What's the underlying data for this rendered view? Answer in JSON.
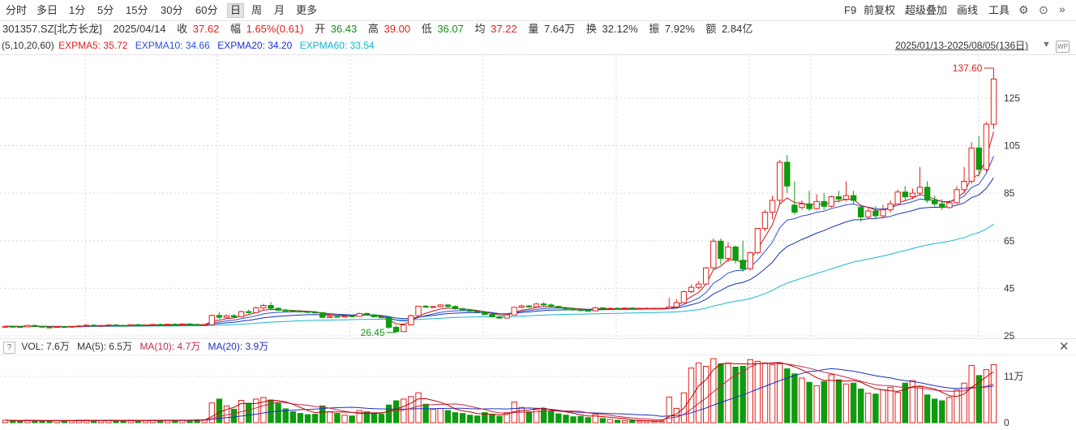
{
  "toolbar": {
    "periods": [
      "分时",
      "多日",
      "1分",
      "5分",
      "15分",
      "30分",
      "60分",
      "日",
      "周",
      "月",
      "更多"
    ],
    "active": "日",
    "right": [
      "F9",
      "前复权",
      "超级叠加",
      "画线",
      "工具"
    ]
  },
  "quote": {
    "code": "301357.SZ[北方长龙]",
    "date": "2025/04/14",
    "close_label": "收",
    "close": "37.62",
    "change_label": "幅",
    "change": "1.65%(0.61)",
    "open_label": "开",
    "open": "36.43",
    "high_label": "高",
    "high": "39.00",
    "low_label": "低",
    "low": "36.07",
    "avg_label": "均",
    "avg": "37.22",
    "vol_label": "量",
    "vol": "7.64万",
    "turnover_label": "换",
    "turnover": "32.12%",
    "amplitude_label": "振",
    "amplitude": "7.92%",
    "amount_label": "额",
    "amount": "2.84亿"
  },
  "ema": {
    "params": "(5,10,20,60)",
    "ema5": "EXPMA5: 35.72",
    "ema10": "EXPMA10: 34.66",
    "ema20": "EXPMA20: 34.20",
    "ema60": "EXPMA60: 33.54"
  },
  "range_label": "2025/01/13-2025/08/05(136日)",
  "vol_panel": {
    "q": "?",
    "vol": "VOL: 7.6万",
    "ma5": "MA(5): 6.5万",
    "ma10": "MA(10): 4.7万",
    "ma20": "MA(20): 3.9万"
  },
  "colors": {
    "up": "#e0201d",
    "down": "#0f9a0f",
    "ema5": "#c2181b",
    "ema10": "#2a4fd8",
    "ema20": "#1432b8",
    "ema60": "#19b8cc",
    "vma5": "#c00000",
    "vma10": "#c22a4a",
    "vma20": "#2030c0"
  },
  "chart_data": {
    "type": "candlestick",
    "ylim": [
      25,
      141
    ],
    "yticks": [
      25,
      45,
      65,
      85,
      105,
      125
    ],
    "vol_ylim": [
      0,
      16
    ],
    "vol_yticks_labels": [
      "0",
      "11万"
    ],
    "vol_yticks_values": [
      0,
      11
    ],
    "annotations": {
      "max": "137.60",
      "min": "26.45"
    },
    "candles": [
      [
        28.8,
        29.3,
        29.0,
        28.5
      ],
      [
        29.0,
        29.4,
        28.9,
        28.6
      ],
      [
        28.9,
        29.2,
        28.8,
        28.4
      ],
      [
        28.8,
        29.6,
        29.4,
        28.6
      ],
      [
        29.4,
        29.7,
        29.0,
        28.8
      ],
      [
        29.0,
        29.3,
        28.7,
        28.5
      ],
      [
        28.7,
        29.0,
        28.6,
        28.3
      ],
      [
        28.6,
        29.1,
        28.9,
        28.4
      ],
      [
        28.9,
        29.2,
        28.7,
        28.5
      ],
      [
        28.7,
        29.1,
        29.0,
        28.5
      ],
      [
        29.0,
        29.5,
        29.2,
        28.8
      ],
      [
        29.2,
        29.8,
        29.5,
        29.0
      ],
      [
        29.5,
        29.9,
        29.3,
        29.1
      ],
      [
        29.3,
        29.6,
        29.4,
        29.0
      ],
      [
        29.4,
        29.8,
        29.6,
        29.2
      ],
      [
        29.6,
        30.0,
        29.4,
        29.2
      ],
      [
        29.4,
        29.7,
        29.3,
        29.0
      ],
      [
        29.3,
        29.9,
        29.7,
        29.1
      ],
      [
        29.7,
        30.1,
        29.5,
        29.3
      ],
      [
        29.5,
        29.8,
        29.6,
        29.2
      ],
      [
        29.6,
        30.0,
        29.8,
        29.4
      ],
      [
        29.8,
        30.2,
        29.6,
        29.4
      ],
      [
        29.6,
        30.0,
        29.9,
        29.4
      ],
      [
        29.9,
        30.3,
        29.7,
        29.5
      ],
      [
        29.7,
        30.1,
        30.0,
        29.5
      ],
      [
        30.0,
        30.4,
        29.8,
        29.6
      ],
      [
        29.8,
        30.2,
        29.5,
        29.3
      ],
      [
        29.5,
        29.9,
        29.7,
        29.2
      ],
      [
        29.7,
        34.0,
        33.6,
        29.5
      ],
      [
        33.6,
        35.0,
        32.8,
        32.0
      ],
      [
        32.8,
        34.0,
        33.5,
        32.4
      ],
      [
        33.5,
        34.2,
        33.0,
        32.6
      ],
      [
        33.0,
        35.6,
        35.2,
        32.8
      ],
      [
        35.2,
        36.0,
        34.8,
        34.2
      ],
      [
        34.8,
        37.2,
        36.8,
        34.6
      ],
      [
        36.8,
        38.5,
        37.8,
        36.0
      ],
      [
        37.8,
        39.2,
        36.6,
        36.2
      ],
      [
        36.6,
        37.0,
        35.8,
        35.4
      ],
      [
        35.8,
        36.4,
        35.6,
        35.2
      ],
      [
        35.6,
        35.9,
        35.4,
        35.0
      ],
      [
        35.4,
        35.8,
        35.2,
        34.8
      ],
      [
        35.2,
        35.6,
        35.0,
        34.6
      ],
      [
        35.0,
        35.5,
        34.8,
        34.5
      ],
      [
        34.8,
        35.0,
        32.8,
        32.4
      ],
      [
        32.8,
        33.5,
        33.2,
        32.5
      ],
      [
        33.2,
        33.8,
        33.0,
        32.6
      ],
      [
        33.0,
        33.6,
        33.4,
        32.8
      ],
      [
        33.4,
        33.9,
        33.2,
        32.8
      ],
      [
        33.2,
        34.8,
        34.4,
        33.0
      ],
      [
        34.4,
        34.8,
        33.8,
        33.5
      ],
      [
        33.8,
        34.2,
        33.0,
        32.8
      ],
      [
        33.0,
        33.4,
        32.8,
        32.5
      ],
      [
        32.8,
        33.0,
        28.6,
        28.0
      ],
      [
        28.6,
        29.5,
        26.8,
        26.45
      ],
      [
        26.8,
        30.0,
        29.6,
        26.6
      ],
      [
        29.6,
        34.0,
        33.5,
        29.4
      ],
      [
        33.5,
        37.6,
        37.5,
        33.2
      ],
      [
        37.5,
        38.0,
        37.1,
        36.8
      ],
      [
        37.1,
        37.6,
        37.3,
        36.8
      ],
      [
        37.3,
        38.4,
        38.0,
        37.0
      ],
      [
        38.0,
        38.4,
        37.4,
        37.0
      ],
      [
        37.4,
        37.8,
        36.4,
        36.0
      ],
      [
        36.4,
        36.8,
        36.0,
        35.6
      ],
      [
        36.0,
        36.4,
        35.4,
        35.0
      ],
      [
        35.4,
        35.8,
        35.0,
        34.6
      ],
      [
        35.0,
        35.4,
        34.0,
        33.8
      ],
      [
        34.0,
        34.4,
        33.0,
        32.8
      ],
      [
        33.0,
        33.4,
        32.5,
        32.2
      ],
      [
        32.5,
        34.0,
        33.8,
        32.3
      ],
      [
        33.8,
        37.2,
        37.0,
        33.6
      ],
      [
        37.0,
        38.2,
        37.6,
        36.6
      ],
      [
        37.6,
        38.0,
        37.2,
        36.8
      ],
      [
        37.2,
        38.8,
        38.4,
        37.0
      ],
      [
        38.4,
        39.2,
        38.0,
        37.6
      ],
      [
        38.0,
        38.6,
        37.4,
        37.0
      ],
      [
        37.4,
        37.8,
        36.8,
        36.5
      ],
      [
        36.8,
        37.2,
        36.4,
        36.0
      ],
      [
        36.4,
        36.8,
        36.0,
        35.6
      ],
      [
        36.0,
        36.5,
        35.7,
        35.4
      ],
      [
        35.7,
        36.1,
        35.5,
        35.2
      ],
      [
        35.5,
        37.2,
        36.8,
        35.4
      ],
      [
        36.8,
        37.1,
        36.5,
        36.2
      ],
      [
        36.5,
        36.9,
        36.6,
        36.2
      ],
      [
        36.6,
        37.0,
        36.4,
        36.1
      ],
      [
        36.4,
        36.9,
        36.7,
        36.2
      ],
      [
        36.7,
        37.0,
        36.5,
        36.2
      ],
      [
        36.5,
        36.9,
        36.6,
        36.2
      ],
      [
        36.6,
        37.0,
        36.6,
        36.3
      ],
      [
        36.6,
        37.0,
        36.6,
        36.3
      ],
      [
        36.6,
        37.0,
        36.6,
        36.3
      ],
      [
        36.6,
        41.0,
        37.2,
        36.4
      ],
      [
        37.2,
        40.4,
        39.0,
        36.8
      ],
      [
        39.0,
        44.0,
        43.6,
        38.6
      ],
      [
        43.6,
        46.6,
        45.4,
        43.0
      ],
      [
        45.4,
        48.0,
        46.8,
        44.6
      ],
      [
        46.8,
        54.0,
        53.6,
        46.4
      ],
      [
        53.6,
        66.0,
        64.8,
        53.0
      ],
      [
        64.8,
        66.0,
        57.6,
        55.0
      ],
      [
        57.6,
        64.4,
        62.4,
        56.0
      ],
      [
        62.4,
        63.0,
        56.8,
        55.4
      ],
      [
        56.8,
        65.0,
        53.2,
        52.0
      ],
      [
        53.2,
        60.4,
        60.0,
        52.6
      ],
      [
        60.0,
        70.4,
        70.2,
        59.4
      ],
      [
        70.2,
        78.0,
        77.0,
        69.0
      ],
      [
        77.0,
        84.0,
        82.0,
        74.0
      ],
      [
        82.0,
        99.0,
        98.0,
        80.0
      ],
      [
        98.0,
        101.0,
        88.0,
        85.0
      ],
      [
        80.0,
        90.0,
        77.0,
        76.0
      ],
      [
        79.0,
        82.0,
        80.5,
        78.0
      ],
      [
        80.5,
        86.0,
        78.5,
        77.5
      ],
      [
        78.5,
        84.5,
        81.5,
        78.0
      ],
      [
        81.5,
        85.0,
        79.5,
        78.0
      ],
      [
        79.5,
        84.0,
        83.5,
        79.0
      ],
      [
        83.5,
        86.0,
        82.5,
        81.0
      ],
      [
        82.5,
        90.0,
        84.0,
        81.5
      ],
      [
        84.0,
        86.0,
        82.0,
        80.5
      ],
      [
        79.0,
        80.0,
        75.0,
        73.0
      ],
      [
        75.0,
        79.0,
        77.5,
        74.0
      ],
      [
        77.5,
        79.5,
        75.5,
        74.0
      ],
      [
        75.5,
        80.0,
        78.0,
        74.5
      ],
      [
        78.0,
        82.0,
        80.5,
        77.0
      ],
      [
        80.5,
        86.5,
        85.5,
        80.0
      ],
      [
        85.5,
        88.0,
        83.5,
        82.0
      ],
      [
        83.5,
        87.0,
        85.0,
        82.5
      ],
      [
        85.0,
        96.0,
        87.5,
        84.0
      ],
      [
        87.5,
        90.0,
        82.0,
        81.0
      ],
      [
        82.0,
        84.0,
        80.5,
        79.5
      ],
      [
        80.5,
        82.5,
        79.0,
        78.0
      ],
      [
        79.0,
        82.0,
        81.0,
        78.5
      ],
      [
        81.0,
        88.0,
        86.5,
        80.5
      ],
      [
        86.5,
        96.0,
        90.0,
        85.0
      ],
      [
        90.0,
        106.5,
        104.0,
        89.0
      ],
      [
        104.0,
        109.0,
        95.0,
        92.0
      ],
      [
        95.0,
        115.0,
        114.0,
        94.0
      ],
      [
        114.0,
        137.6,
        133.0,
        112.0
      ]
    ],
    "volume": [
      0.6,
      0.5,
      0.4,
      0.6,
      0.5,
      0.5,
      0.4,
      0.5,
      0.5,
      0.5,
      0.6,
      0.6,
      0.5,
      0.5,
      0.6,
      0.5,
      0.5,
      0.6,
      0.5,
      0.5,
      0.6,
      0.6,
      0.6,
      0.6,
      0.6,
      0.6,
      0.7,
      0.7,
      4.7,
      5.6,
      4.0,
      3.2,
      5.3,
      4.6,
      5.6,
      6.0,
      5.4,
      4.6,
      3.3,
      2.6,
      2.2,
      1.9,
      2.0,
      4.0,
      2.6,
      2.2,
      1.8,
      1.6,
      2.9,
      2.6,
      2.2,
      2.0,
      4.2,
      5.2,
      5.6,
      6.2,
      7.1,
      4.4,
      3.2,
      3.4,
      2.9,
      2.4,
      2.2,
      1.8,
      1.6,
      2.4,
      2.0,
      1.5,
      2.4,
      4.9,
      3.6,
      2.6,
      3.1,
      3.2,
      2.7,
      2.1,
      1.8,
      1.4,
      1.5,
      1.2,
      2.0,
      1.0,
      0.8,
      0.6,
      0.5,
      0.5,
      0.4,
      0.4,
      0.3,
      0.3,
      6.1,
      3.4,
      7.1,
      13.0,
      14.2,
      13.4,
      15.2,
      14.0,
      14.1,
      13.2,
      13.4,
      15.0,
      14.6,
      14.2,
      13.8,
      14.0,
      12.8,
      11.6,
      10.6,
      9.6,
      8.8,
      9.8,
      11.4,
      10.2,
      9.2,
      9.4,
      8.0,
      7.0,
      6.8,
      7.8,
      8.4,
      7.2,
      9.4,
      10.0,
      8.6,
      6.6,
      5.6,
      5.2,
      6.0,
      7.8,
      9.4,
      13.6,
      11.2,
      12.6,
      13.8
    ]
  }
}
